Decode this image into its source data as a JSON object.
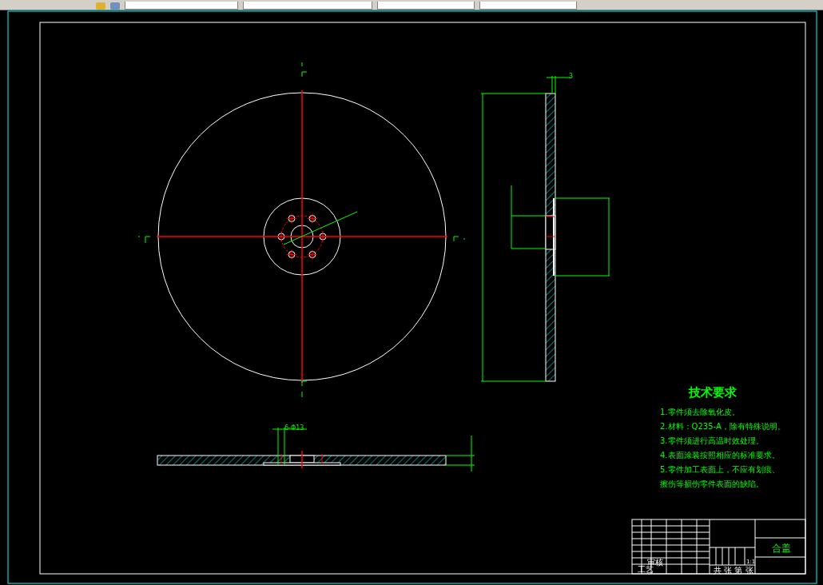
{
  "annotations": [
    {
      "text": "6-Φ13"
    },
    {
      "text": "3"
    }
  ],
  "technical_requirements": {
    "title": "技术要求",
    "items": [
      "1.零件须去除氧化皮。",
      "2.材料：Q235-A，除有特殊说明。",
      "3.零件须进行高温时效处理。",
      "4.表面涂装按照相应的标准要求。",
      "5.零件加工表面上，不应有划痕、",
      "擦伤等损伤零件表面的缺陷。"
    ]
  },
  "title_block": {
    "part_name": "合盖",
    "scale": "1:1",
    "sheet": "共 张 第 张",
    "labels": [
      "审核",
      "工艺"
    ]
  }
}
